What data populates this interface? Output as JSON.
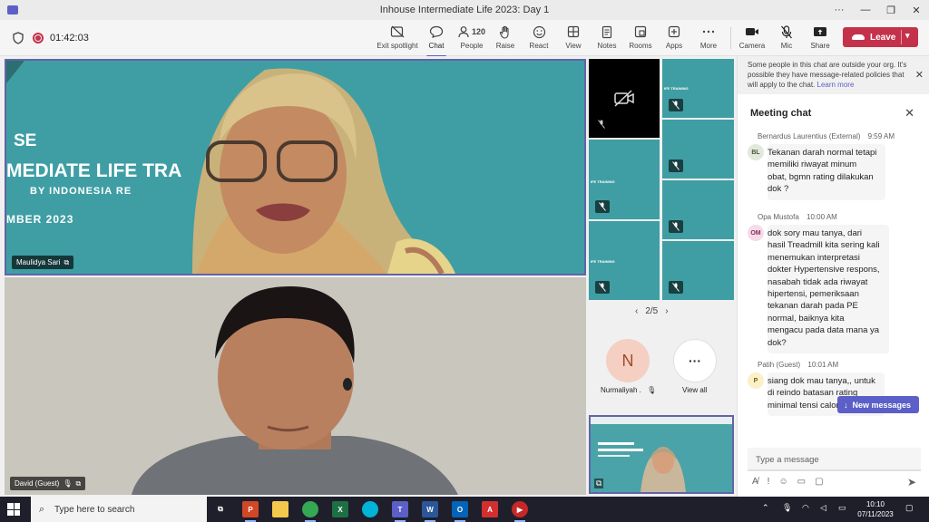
{
  "window": {
    "title": "Inhouse Intermediate Life 2023: Day 1",
    "controls": {
      "more": "···",
      "minimize": "—",
      "maximize": "❐",
      "close": "✕"
    }
  },
  "toolbar": {
    "timer": "01:42:03",
    "buttons": [
      {
        "label": "Exit spotlight",
        "icon": "exit-spotlight-icon"
      },
      {
        "label": "Chat",
        "icon": "chat-icon"
      },
      {
        "label": "People",
        "icon": "people-icon",
        "count": "120"
      },
      {
        "label": "Raise",
        "icon": "hand-icon"
      },
      {
        "label": "React",
        "icon": "emoji-icon"
      },
      {
        "label": "View",
        "icon": "grid-icon"
      },
      {
        "label": "Notes",
        "icon": "notes-icon"
      },
      {
        "label": "Rooms",
        "icon": "rooms-icon"
      },
      {
        "label": "Apps",
        "icon": "apps-icon"
      },
      {
        "label": "More",
        "icon": "more-icon"
      }
    ],
    "devices": [
      {
        "label": "Camera",
        "icon": "camera-icon"
      },
      {
        "label": "Mic",
        "icon": "mic-off-icon"
      },
      {
        "label": "Share",
        "icon": "share-icon"
      }
    ],
    "leave_label": "Leave"
  },
  "stage": {
    "speaker1": {
      "name": "Maulidya Sari",
      "slide": {
        "line1": "SE",
        "line2": "MEDIATE LIFE TRA",
        "line3": "BY INDONESIA RE",
        "line4": "MBER 2023"
      }
    },
    "speaker2": {
      "name": "David (Guest)"
    },
    "tile_label": "IFE TRAINING",
    "pager": "2/5",
    "overflow_person": {
      "initial": "N",
      "name": "Nurmaliyah ."
    },
    "view_all": "View all"
  },
  "chat": {
    "banner": "Some people in this chat are outside your org. It's possible they have message-related policies that will apply to the chat.",
    "banner_link": "Learn more",
    "title": "Meeting chat",
    "messages": [
      {
        "author": "Bernardus Laurentius (External)",
        "time": "9:59 AM",
        "initials": "BL",
        "text": "Tekanan darah normal tetapi\nmemiliki riwayat minum\nobat, bgmn rating dilakukan\ndok ?"
      },
      {
        "author": "Opa Mustofa",
        "time": "10:00 AM",
        "initials": "OM",
        "text": "dok sory mau tanya, dari\nhasil Treadmill kita sering kali\nmenemukan interpretasi\ndokter Hypertensive respons,\nnasabah tidak ada riwayat\nhipertensi, pemeriksaan\ntekanan darah pada PE\nnormal, baiknya kita\nmengacu pada data mana ya\ndok?"
      },
      {
        "author": "Patih (Guest)",
        "time": "10:01 AM",
        "initials": "P",
        "text": "siang dok mau tanya,, untuk\ndi reindo batasan rating\nminimal tensi calon"
      }
    ],
    "new_messages": "New messages",
    "compose_placeholder": "Type a message"
  },
  "taskbar": {
    "search_placeholder": "Type here to search",
    "time": "10:10",
    "date": "07/11/2023"
  },
  "colors": {
    "accent": "#5b5fc7",
    "leave": "#c4314b",
    "slide_teal": "#3f9ea4"
  }
}
